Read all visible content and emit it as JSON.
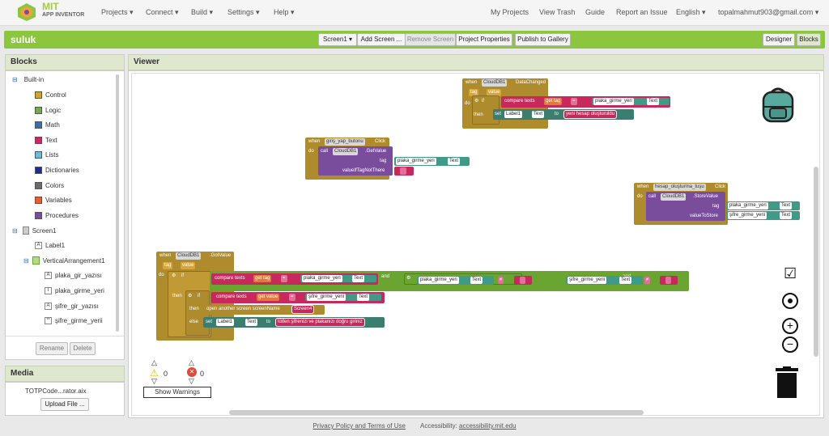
{
  "topbar": {
    "logo_title": "MIT",
    "logo_sub": "APP INVENTOR",
    "menus": [
      "Projects ▾",
      "Connect ▾",
      "Build ▾",
      "Settings ▾",
      "Help ▾"
    ],
    "right_links": [
      "My Projects",
      "View Trash",
      "Guide",
      "Report an Issue",
      "English ▾",
      "topalmahmut903@gmail.com ▾"
    ]
  },
  "projbar": {
    "name": "suluk",
    "screen": "Screen1 ▾",
    "add_screen": "Add Screen ...",
    "remove_screen": "Remove Screen",
    "project_properties": "Project Properties",
    "publish": "Publish to Gallery",
    "designer": "Designer",
    "blocks": "Blocks"
  },
  "blocks_panel": {
    "title": "Blocks",
    "builtin": "Built-in",
    "items": [
      "Control",
      "Logic",
      "Math",
      "Text",
      "Lists",
      "Dictionaries",
      "Colors",
      "Variables",
      "Procedures"
    ],
    "colors": [
      "#c9a63a",
      "#77a94a",
      "#3e6ea8",
      "#c8295c",
      "#76b7d9",
      "#1c2d8e",
      "#6b6b6b",
      "#e05f33",
      "#7a4c9c"
    ],
    "screen": "Screen1",
    "components": [
      "Label1",
      "VerticalArrangement1",
      "plaka_gir_yazısı",
      "plaka_girme_yeri",
      "şifre_gir_yazısı",
      "şifre_girme_yerii"
    ],
    "rename": "Rename",
    "delete": "Delete"
  },
  "media_panel": {
    "title": "Media",
    "file": "TOTPCode...rator.aix",
    "upload": "Upload File ..."
  },
  "viewer": {
    "title": "Viewer",
    "warn_count": "0",
    "error_count": "0",
    "show_warnings": "Show Warnings"
  },
  "block_text": {
    "when": "when",
    "do": "do",
    "call": "call",
    "set": "set",
    "to": "to",
    "if": "if",
    "then": "then",
    "else": "else",
    "get": "get",
    "and": "and",
    "tag": "tag",
    "value": "value",
    "compare_texts": "compare texts",
    "eq": "=",
    "ne": "≠",
    "text": "Text",
    "cloud": "CloudDB1",
    "label1": "Label1",
    "screen4": "Screen4",
    "data_changed": "DataChanged",
    "click": "Click",
    "get_value": ".GetValue",
    "got_value": ".GotValue",
    "store_value": ".StoreValue",
    "value_if_missing": "valueIfTagNotThere",
    "value_to_store": "valueToStore",
    "giris_btn": "giriş_yap_butonu",
    "hesap_btn": "hesap_oluşturma_tuşu",
    "plaka": "plaka_girme_yeri",
    "sifre": "şifre_girme_yerii",
    "msg_created": "yeni hesap oluşturuldu",
    "msg_wrong": "lütfen şifrenizi ve plakanızı doğru giriniz",
    "open_screen": "open another screen  screenName"
  },
  "footer": {
    "privacy": "Privacy Policy and Terms of Use",
    "accessibility_label": "Accessibility:",
    "accessibility_link": "accessibility.mit.edu"
  }
}
